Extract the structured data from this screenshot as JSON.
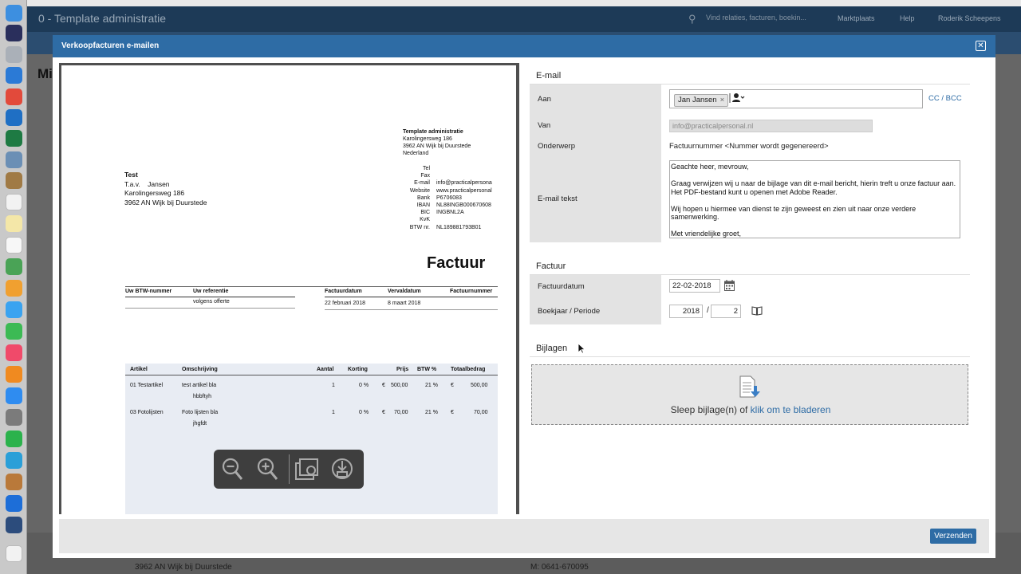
{
  "background_app": {
    "company_name": "0 - Template administratie",
    "search_placeholder": "Vind relaties, facturen, boekin...",
    "nav": {
      "marketplace": "Marktplaats",
      "help": "Help",
      "user": "Roderik Scheepens"
    },
    "page_heading": "Mi",
    "footer_address_line": "3962 AN Wijk bij Duurstede",
    "footer_phone_line": "M: 0641-670095"
  },
  "modal": {
    "title": "Verkoopfacturen e-mailen",
    "close_icon": "close-icon",
    "send_label": "Verzenden",
    "accent_color": "#2e6ca5"
  },
  "invoice_preview": {
    "sender": {
      "name": "Template administratie",
      "street": "Karolingersweg 186",
      "city": "3962 AN  Wijk bij Duurstede",
      "country": "Nederland"
    },
    "sender_details": {
      "labels": [
        "Tel",
        "Fax",
        "E-mail",
        "Website",
        "Bank",
        "IBAN",
        "BIC",
        "KvK",
        "BTW nr."
      ],
      "values": [
        "",
        "",
        "info@practicalpersona",
        "www.practicalpersonal",
        "P6706083",
        "NL88INGB000670608",
        "INGBNL2A",
        "",
        "NL189881793B01"
      ]
    },
    "addressee": {
      "name": "Test",
      "attention": "T.a.v.    Jansen",
      "street": "Karolingersweg 186",
      "city": "3962 AN  Wijk bij Duurstede"
    },
    "title": "Factuur",
    "header_fields": {
      "vat_number_label": "Uw BTW-nummer",
      "reference_label": "Uw referentie",
      "reference_value": "volgens offerte",
      "invoice_date_label": "Factuurdatum",
      "invoice_date_value": "22 februari 2018",
      "due_date_label": "Vervaldatum",
      "due_date_value": "8 maart 2018",
      "invoice_number_label": "Factuurnummer"
    },
    "lines": {
      "columns": [
        "Artikel",
        "Omschrijving",
        "Aantal",
        "Korting",
        "Prijs",
        "BTW %",
        "Totaalbedrag"
      ],
      "rows": [
        {
          "article": "01 Testartikel",
          "description": "test artikel bla",
          "description2": "hbbftyh",
          "qty": "1",
          "discount": "0 %",
          "currency": "€",
          "price": "500,00",
          "vat": "21 %",
          "currency2": "€",
          "total": "500,00"
        },
        {
          "article": "03 Fotolijsten",
          "description": "Foto lijsten bla",
          "description2": "jhgfdt",
          "qty": "1",
          "discount": "0 %",
          "currency": "€",
          "price": "70,00",
          "vat": "21 %",
          "currency2": "€",
          "total": "70,00"
        }
      ]
    },
    "toolbar_icons": [
      "zoom-out-icon",
      "zoom-in-icon",
      "images-icon",
      "download-icon"
    ]
  },
  "email_section": {
    "title": "E-mail",
    "to_label": "Aan",
    "to_chip": "Jan Jansen",
    "chip_remove": "×",
    "add_recipient_icon": "person-add-icon",
    "cc_label": "CC",
    "cc_separator": "/",
    "bcc_label": "BCC",
    "from_label": "Van",
    "from_placeholder": "info@practicalpersonal.nl",
    "subject_label": "Onderwerp",
    "subject_value": "Factuurnummer <Nummer wordt gegenereerd>",
    "body_label": "E-mail tekst",
    "body_lines": [
      "Geachte heer, mevrouw,",
      "",
      "Graag verwijzen wij u naar de bijlage van dit e-mail bericht, hierin treft u onze factuur aan.",
      "Het PDF-bestand kunt u openen met Adobe Reader.",
      "",
      "Wij hopen u hiermee van dienst te zijn geweest en zien uit naar onze verdere",
      "samenwerking.",
      "",
      "Met vriendelijke groet,"
    ]
  },
  "invoice_section": {
    "title": "Factuur",
    "date_label": "Factuurdatum",
    "date_value": "22-02-2018",
    "period_label": "Boekjaar / Periode",
    "year_value": "2018",
    "period_separator": "/",
    "period_value": "2"
  },
  "attachments_section": {
    "title": "Bijlagen",
    "drop_text": "Sleep bijlage(n) of ",
    "drop_link": "klik om te bladeren"
  }
}
